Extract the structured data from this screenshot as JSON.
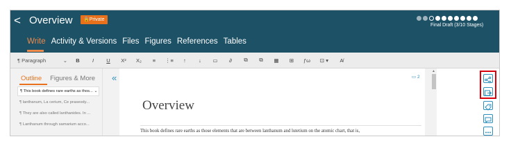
{
  "header": {
    "back_glyph": "<",
    "title": "Overview",
    "badge": "Private",
    "stage_label": "Final Draft (3/10 Stages)",
    "stages": {
      "completed": 2,
      "current": 1,
      "remaining": 7
    },
    "tabs": [
      {
        "label": "Write",
        "active": true
      },
      {
        "label": "Activity & Versions",
        "active": false
      },
      {
        "label": "Files",
        "active": false
      },
      {
        "label": "Figures",
        "active": false
      },
      {
        "label": "References",
        "active": false
      },
      {
        "label": "Tables",
        "active": false
      }
    ]
  },
  "toolbar": {
    "paragraph_label": "Paragraph",
    "paragraph_chevron": "⌄",
    "bold": "B",
    "italic": "I",
    "underline": "U",
    "superscript": "X²",
    "subscript": "X₂",
    "bullet_list": "≡",
    "numbered_list": "⋮≡",
    "move_up": "↑",
    "move_down": "↓",
    "comment": "▭",
    "link": "∂",
    "insert_figure": "⧉",
    "insert_figure_alt": "⧉",
    "table": "▦",
    "grid": "⊞",
    "formula": "ƒω",
    "more": "⊡ ▾",
    "clear_formatting": "A̸"
  },
  "sidebar": {
    "tabs": [
      {
        "label": "Outline",
        "active": true
      },
      {
        "label": "Figures & More",
        "active": false
      }
    ],
    "items": [
      {
        "text": "¶ This book defines rare earths as thos... ⌄",
        "selected": true
      },
      {
        "text": "¶ lanthanum, La cerium, Ce praseody...",
        "selected": false
      },
      {
        "text": "¶ They are also called lanthanides. In ...",
        "selected": false
      },
      {
        "text": "¶ Lanthanum through samarium acco...",
        "selected": false
      }
    ]
  },
  "editor": {
    "collapse_glyph": "«",
    "comment_count": "▭ 2",
    "heading": "Overview",
    "paragraph": "This book defines rare earths as those elements that are between lanthanum and lutetium on the atomic chart, that is,"
  },
  "rail": {
    "icons": [
      "share-icon",
      "export-icon",
      "tag-icon",
      "comment-icon",
      "more-icon"
    ],
    "highlight_color": "#d8000c"
  },
  "colors": {
    "header_bg": "#1c5166",
    "accent": "#e9711c",
    "link_blue": "#2e8fbd"
  }
}
